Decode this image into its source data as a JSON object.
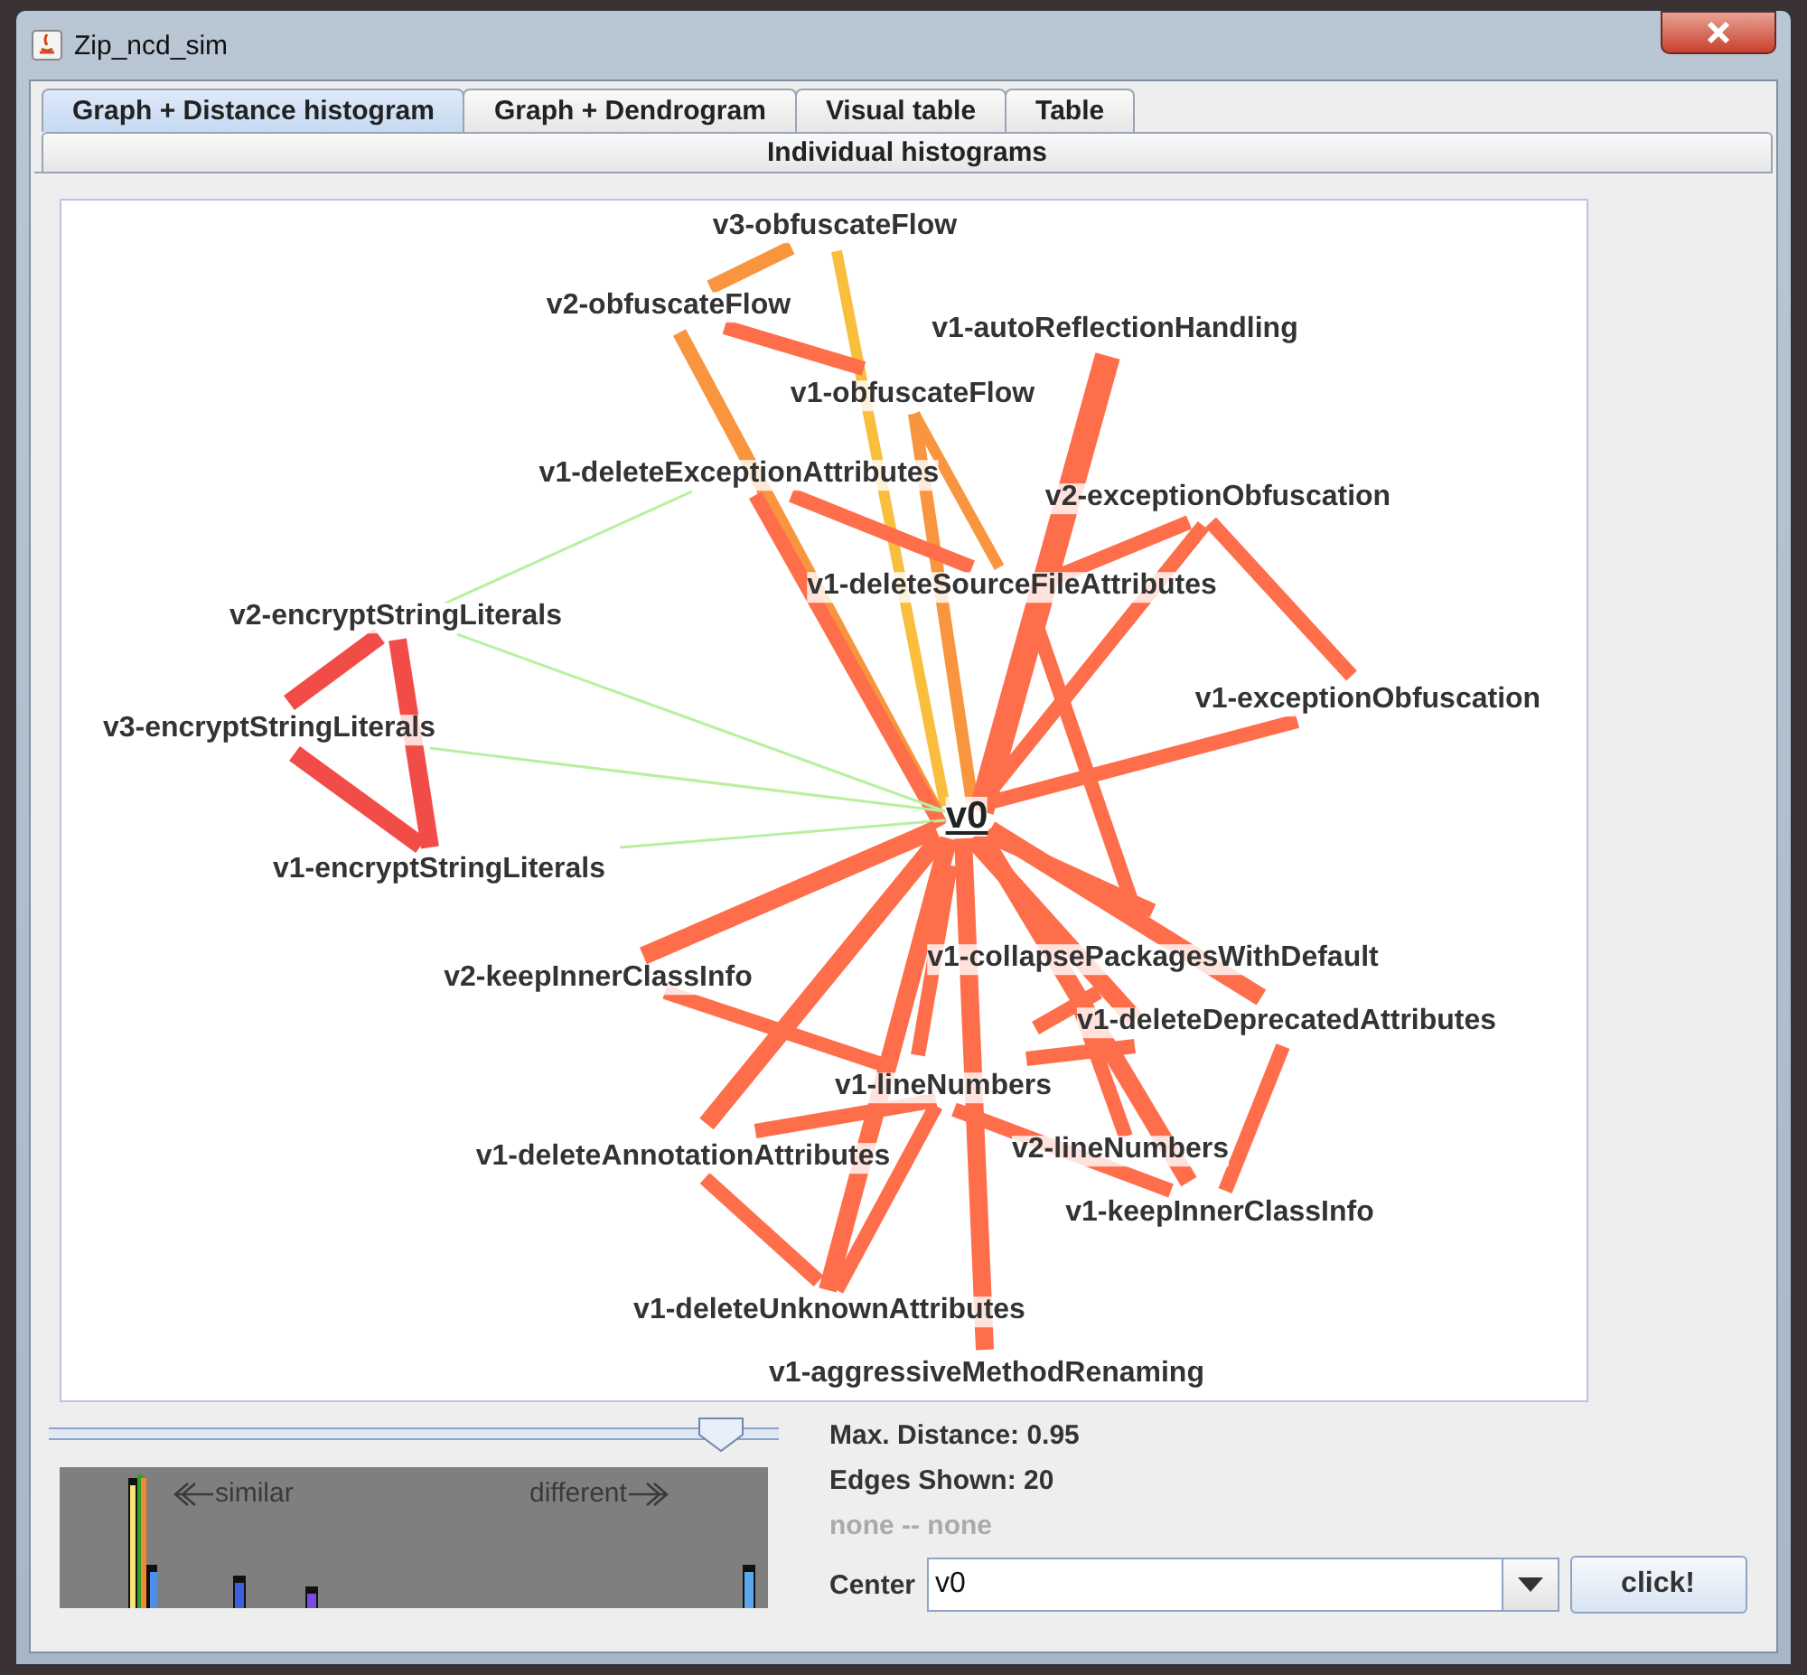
{
  "window": {
    "title": "Zip_ncd_sim"
  },
  "tab_rows": [
    [
      {
        "label": "Graph + Distance histogram",
        "selected": true
      },
      {
        "label": "Graph + Dendrogram",
        "selected": false
      },
      {
        "label": "Visual table",
        "selected": false
      },
      {
        "label": "Table",
        "selected": false
      }
    ],
    [
      {
        "label": "Individual histograms",
        "selected": false
      }
    ]
  ],
  "graph": {
    "nodes": [
      {
        "label": "v3-obfuscateFlow",
        "kind": "node"
      },
      {
        "label": "v2-obfuscateFlow",
        "kind": "node"
      },
      {
        "label": "v1-autoReflectionHandling",
        "kind": "node"
      },
      {
        "label": "v1-obfuscateFlow",
        "kind": "node"
      },
      {
        "label": "v1-deleteExceptionAttributes",
        "kind": "node"
      },
      {
        "label": "v2-exceptionObfuscation",
        "kind": "node"
      },
      {
        "label": "v1-deleteSourceFileAttributes",
        "kind": "node"
      },
      {
        "label": "v2-encryptStringLiterals",
        "kind": "node"
      },
      {
        "label": "v3-encryptStringLiterals",
        "kind": "node"
      },
      {
        "label": "v1-exceptionObfuscation",
        "kind": "node"
      },
      {
        "label": "v0",
        "kind": "center"
      },
      {
        "label": "v1-encryptStringLiterals",
        "kind": "node"
      },
      {
        "label": "v2-keepInnerClassInfo",
        "kind": "node"
      },
      {
        "label": "v1-collapsePackagesWithDefault",
        "kind": "node"
      },
      {
        "label": "v1-deleteDeprecatedAttributes",
        "kind": "node"
      },
      {
        "label": "v1-lineNumbers",
        "kind": "node"
      },
      {
        "label": "v2-lineNumbers",
        "kind": "node"
      },
      {
        "label": "v1-deleteAnnotationAttributes",
        "kind": "node"
      },
      {
        "label": "v1-keepInnerClassInfo",
        "kind": "node"
      },
      {
        "label": "v1-deleteUnknownAttributes",
        "kind": "node"
      },
      {
        "label": "v1-aggressiveMethodRenaming",
        "kind": "node"
      }
    ]
  },
  "slider": {
    "level": 0.95
  },
  "histogram": {
    "left_label": "similar",
    "right_label": "different"
  },
  "info": {
    "max_distance": "Max. Distance: 0.95",
    "edges_shown": "Edges Shown: 20",
    "selection": "none -- none"
  },
  "center": {
    "label": "Center",
    "value": "v0"
  },
  "buttons": [
    "click!"
  ]
}
